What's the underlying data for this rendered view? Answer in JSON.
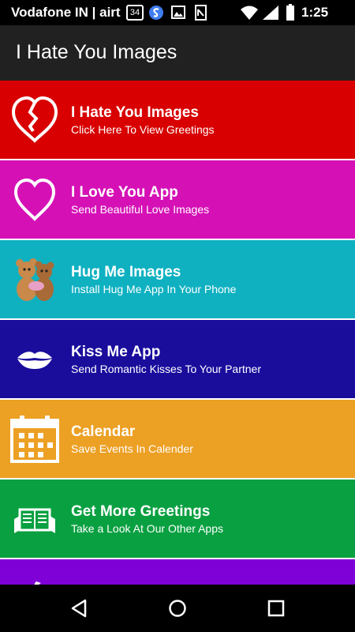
{
  "status": {
    "carrier": "Vodafone IN | airt",
    "badge": "34",
    "time": "1:25"
  },
  "appbar": {
    "title": "I Hate You Images"
  },
  "items": [
    {
      "title": "I Hate You Images",
      "subtitle": "Click Here To View Greetings",
      "color": "#d80000",
      "icon": "broken-heart-icon"
    },
    {
      "title": "I Love You App",
      "subtitle": "Send Beautiful Love Images",
      "color": "#d511b6",
      "icon": "heart-icon"
    },
    {
      "title": "Hug Me Images",
      "subtitle": "Install Hug Me App In Your Phone",
      "color": "#0fb1c1",
      "icon": "teddy-bears-icon"
    },
    {
      "title": "Kiss Me App",
      "subtitle": "Send Romantic Kisses To Your Partner",
      "color": "#1a0d9c",
      "icon": "lips-icon"
    },
    {
      "title": "Calendar",
      "subtitle": "Save Events In Calender",
      "color": "#eca024",
      "icon": "calendar-icon"
    },
    {
      "title": "Get More Greetings",
      "subtitle": "Take a Look At Our Other Apps",
      "color": "#09a041",
      "icon": "newspaper-icon"
    },
    {
      "title": "",
      "subtitle": "",
      "color": "#8000d8",
      "icon": "moon-icon"
    }
  ],
  "navbar": {
    "back_icon": "back-triangle-icon",
    "home_icon": "home-circle-icon",
    "recents_icon": "recents-square-icon"
  }
}
